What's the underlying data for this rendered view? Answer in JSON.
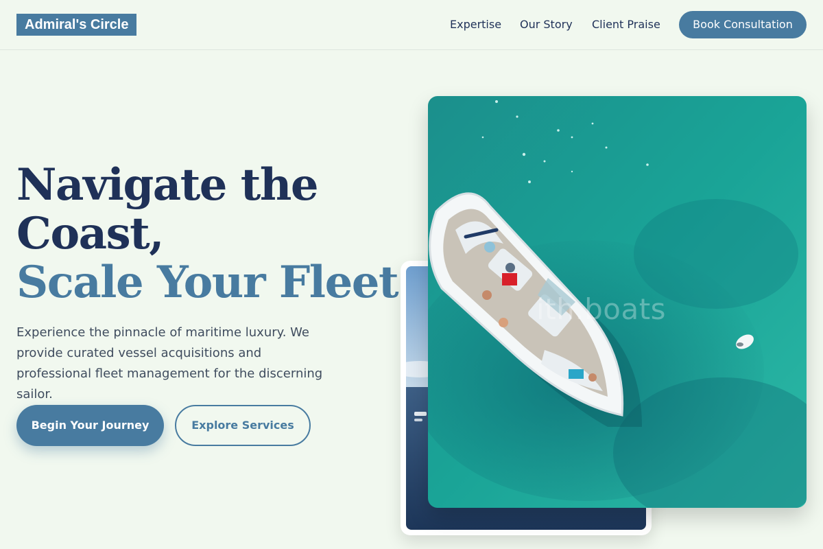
{
  "header": {
    "logo": "Admiral's Circle",
    "nav": [
      "Expertise",
      "Our Story",
      "Client Praise"
    ],
    "cta": "Book Consultation"
  },
  "hero": {
    "headline_line1": "Navigate the",
    "headline_line2": "Coast,",
    "headline_accent": "Scale Your Fleet.",
    "lede": "Experience the pinnacle of maritime luxury. We provide curated vessel acquisitions and professional fleet management for the discerning sailor.",
    "primary_button": "Begin Your Journey",
    "secondary_button": "Explore Services"
  },
  "images": {
    "watermark": "ith.boats"
  },
  "colors": {
    "background": "#f1f8ef",
    "brand": "#487ba0",
    "navy": "#1f3158",
    "water": "#1ea59a"
  }
}
